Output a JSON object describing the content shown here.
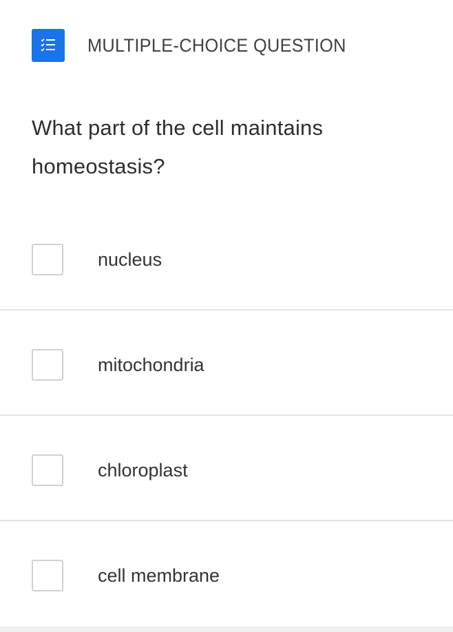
{
  "header": {
    "icon": "checklist-icon",
    "title": "MULTIPLE-CHOICE QUESTION",
    "accent_color": "#1a73e8"
  },
  "question": {
    "text": "What part of the cell maintains homeostasis?"
  },
  "options": [
    {
      "label": "nucleus",
      "checked": false
    },
    {
      "label": "mitochondria",
      "checked": false
    },
    {
      "label": "chloroplast",
      "checked": false
    },
    {
      "label": "cell membrane",
      "checked": false
    }
  ]
}
